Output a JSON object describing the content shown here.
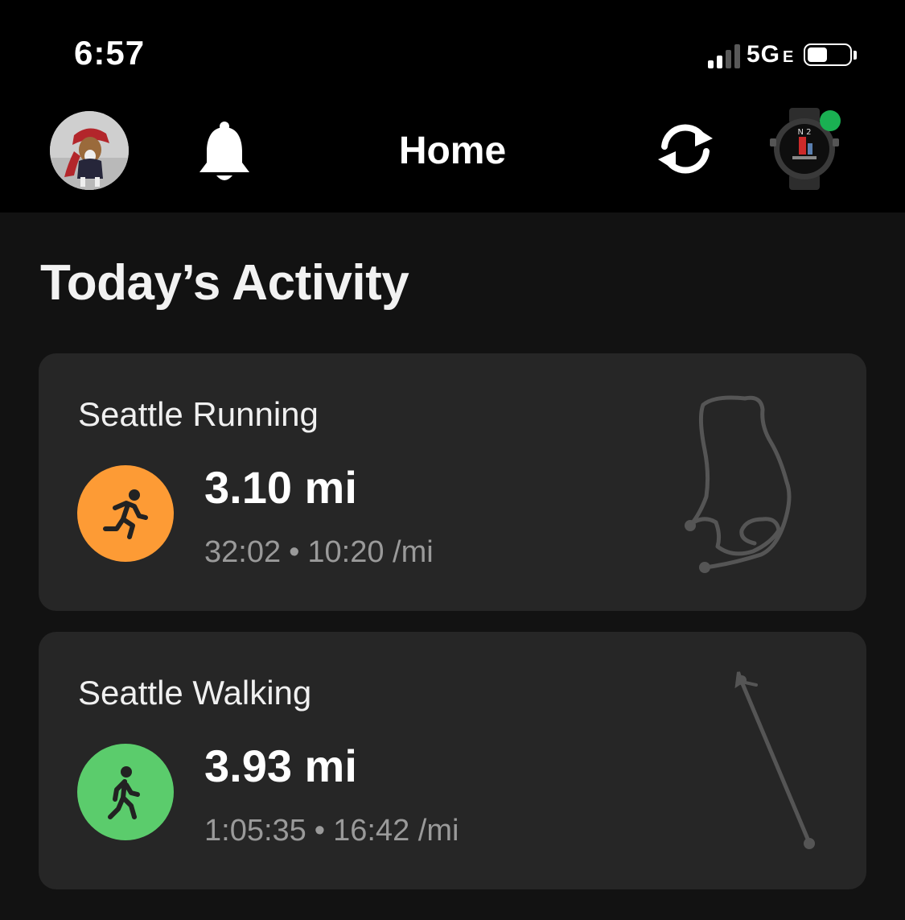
{
  "status_bar": {
    "time": "6:57",
    "network": "5G",
    "network_suffix": "E",
    "signal_bars": 4,
    "signal_bars_active": 2,
    "battery_level": 0.5
  },
  "nav": {
    "title": "Home",
    "device_status_color": "#1ab052"
  },
  "section": {
    "title": "Today’s Activity"
  },
  "activities": [
    {
      "title": "Seattle Running",
      "distance": "3.10 mi",
      "duration": "32:02",
      "separator": "•",
      "pace": "10:20 /mi",
      "icon": "running-icon",
      "icon_color": "#fd9b35"
    },
    {
      "title": "Seattle Walking",
      "distance": "3.93 mi",
      "duration": "1:05:35",
      "separator": "•",
      "pace": "16:42 /mi",
      "icon": "walking-icon",
      "icon_color": "#5bcc6c"
    }
  ]
}
